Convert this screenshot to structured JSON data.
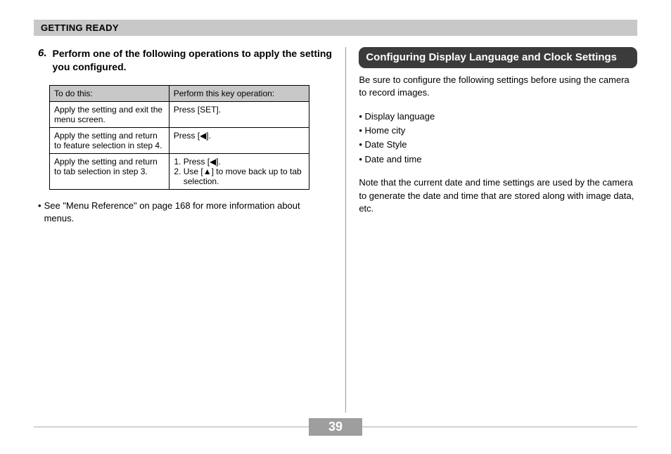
{
  "header": {
    "section_title": "GETTING READY"
  },
  "left": {
    "step_number": "6.",
    "step_text": "Perform one of the following operations to apply the setting you configured.",
    "table": {
      "headers": [
        "To do this:",
        "Perform this key operation:"
      ],
      "rows": [
        {
          "a": "Apply the setting and exit the menu screen.",
          "b": "Press [SET]."
        },
        {
          "a": "Apply the setting and return to feature selection in step 4.",
          "b": "Press [◀]."
        },
        {
          "a": "Apply the setting and return to tab selection in step 3.",
          "b_list": [
            "Press [◀].",
            "Use [▲] to move back up to tab selection."
          ]
        }
      ]
    },
    "bullet_note": "See \"Menu Reference\" on page 168 for more information about menus."
  },
  "right": {
    "callout_title": "Configuring Display Language and Clock Settings",
    "intro": "Be sure to configure the following settings before using the camera to record images.",
    "bullets": [
      "Display language",
      "Home city",
      "Date Style",
      "Date and time"
    ],
    "note": "Note that the current date and time settings are used by the camera to generate the date and time that are stored along with image data, etc."
  },
  "page_number": "39"
}
